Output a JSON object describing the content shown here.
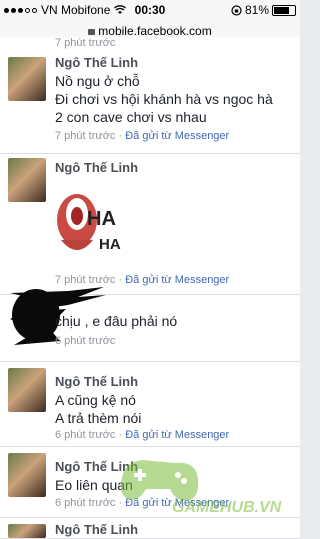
{
  "status": {
    "carrier": "VN Mobifone",
    "time": "00:30",
    "battery": "81%",
    "battery_level": 0.81
  },
  "url": "mobile.facebook.com",
  "messages": [
    {
      "time": "7 phút trước"
    },
    {
      "name": "",
      "lines": [
        "Nồ ngu ở chỗ",
        "Đi chơi vs hội khánh hà vs ngoc hà",
        "2 con cave chơi vs nhau"
      ],
      "time": "7 phút trước",
      "sent_via": "Đã gửi từ Messenger"
    },
    {
      "name": "Ngô Thế Linh",
      "sticker_text": [
        "HA",
        "HA"
      ],
      "time": "7 phút trước",
      "sent_via": "Đã gửi từ Messenger"
    },
    {
      "lines": [
        "chịu , e đâu phải nó"
      ],
      "time": "6 phút trước"
    },
    {
      "name": "Ngô Thế Linh",
      "lines": [
        "A cũng kệ nó",
        "A trả thèm nói"
      ],
      "time": "6 phút trước",
      "sent_via": "Đã gửi từ Messenger"
    },
    {
      "name": "Ngô Thế Linh",
      "lines": [
        "Eo liên quan"
      ],
      "time": "6 phút trước",
      "sent_via": "Đã gửi từ Messenger"
    },
    {
      "name": "Ngô Thế Linh"
    }
  ],
  "first_name": "Ngô Thế Linh",
  "watermark": "GAMEHUB.VN"
}
